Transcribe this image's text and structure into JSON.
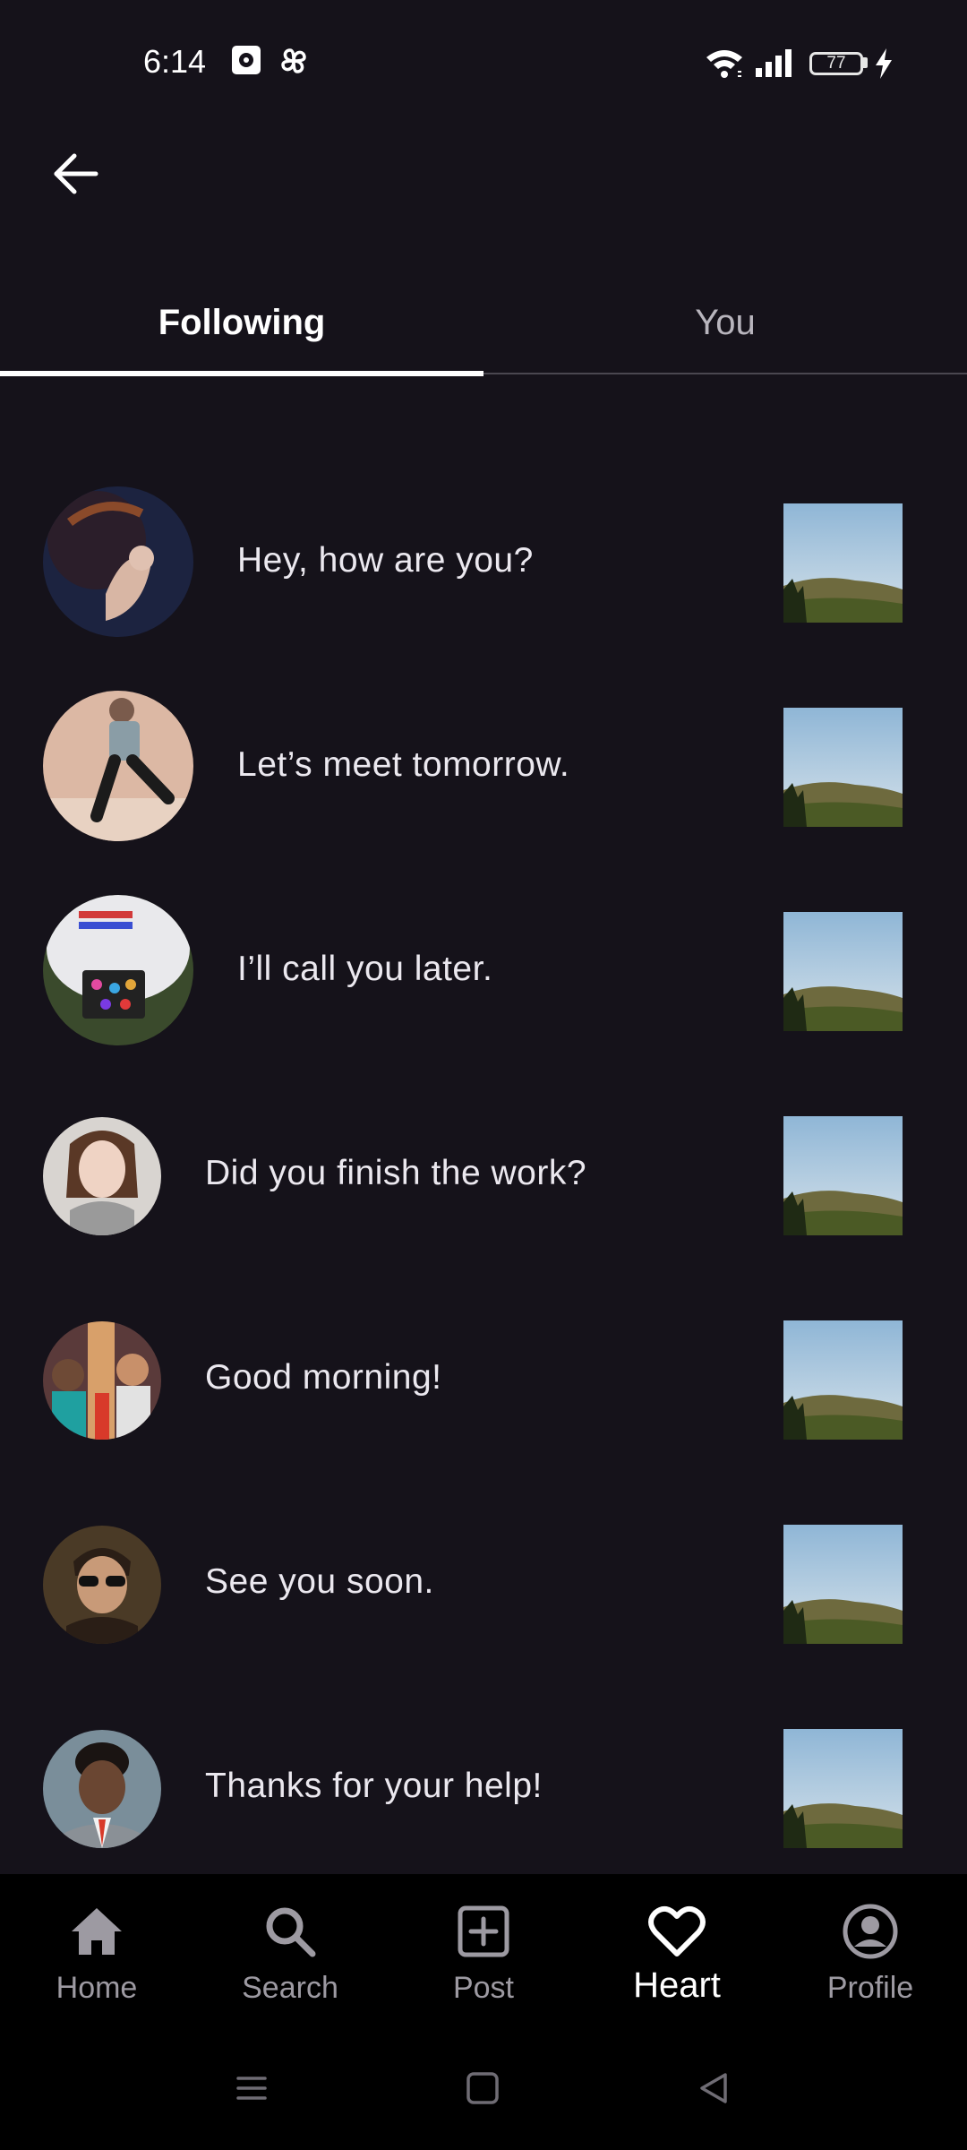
{
  "status_bar": {
    "time": "6:14",
    "battery": "77",
    "icons": [
      "notification-icon",
      "pinwheel-icon",
      "wifi-icon",
      "signal-icon",
      "battery-icon",
      "charging-icon"
    ]
  },
  "header": {
    "back_icon": "arrow-left-icon"
  },
  "tabs": [
    {
      "label": "Following",
      "selected": true
    },
    {
      "label": "You",
      "selected": false
    }
  ],
  "messages": [
    {
      "text": "Hey, how are you?",
      "avatar": "hand-photo"
    },
    {
      "text": "Let’s meet tomorrow.",
      "avatar": "skater-photo"
    },
    {
      "text": "I’ll call you later.",
      "avatar": "robot-photo"
    },
    {
      "text": "Did you finish the work?",
      "avatar": "woman-photo"
    },
    {
      "text": "Good morning!",
      "avatar": "group-photo"
    },
    {
      "text": "See you soon.",
      "avatar": "man-sunglasses-photo"
    },
    {
      "text": "Thanks for your help!",
      "avatar": "man-suit-photo"
    }
  ],
  "bottom_nav": [
    {
      "label": "Home",
      "icon": "home-icon",
      "active": false
    },
    {
      "label": "Search",
      "icon": "search-icon",
      "active": false
    },
    {
      "label": "Post",
      "icon": "add-box-icon",
      "active": false
    },
    {
      "label": "Heart",
      "icon": "heart-icon",
      "active": true
    },
    {
      "label": "Profile",
      "icon": "profile-icon",
      "active": false
    }
  ],
  "colors": {
    "background": "#15121a",
    "nav_background": "#000000",
    "active": "#ffffff",
    "inactive": "#9d9aa2"
  }
}
